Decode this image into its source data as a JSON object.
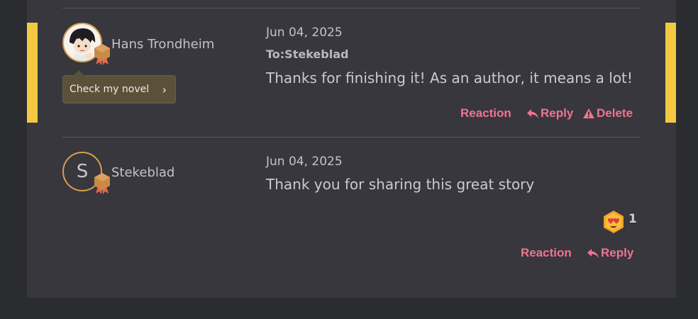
{
  "comments": [
    {
      "username": "Hans Trondheim",
      "date": "Jun 04, 2025",
      "to_line": "To:Stekeblad",
      "text": "Thanks for finishing it! As an author, it means a lot!",
      "tooltip_label": "Check my novel",
      "actions": {
        "reaction": "Reaction",
        "reply": "Reply",
        "delete": "Delete"
      }
    },
    {
      "avatar_letter": "S",
      "username": "Stekeblad",
      "date": "Jun 04, 2025",
      "text": "Thank you for sharing this great story",
      "reaction_count": "1",
      "actions": {
        "reaction": "Reaction",
        "reply": "Reply"
      }
    }
  ],
  "colors": {
    "accent": "#f4c843",
    "action": "#f0738f",
    "avatar_border": "#d99d4c"
  },
  "icons": [
    "reply-arrow-icon",
    "warning-triangle-icon",
    "chevron-right-icon",
    "heart-eyes-emoji-icon",
    "level-badge-icon"
  ]
}
